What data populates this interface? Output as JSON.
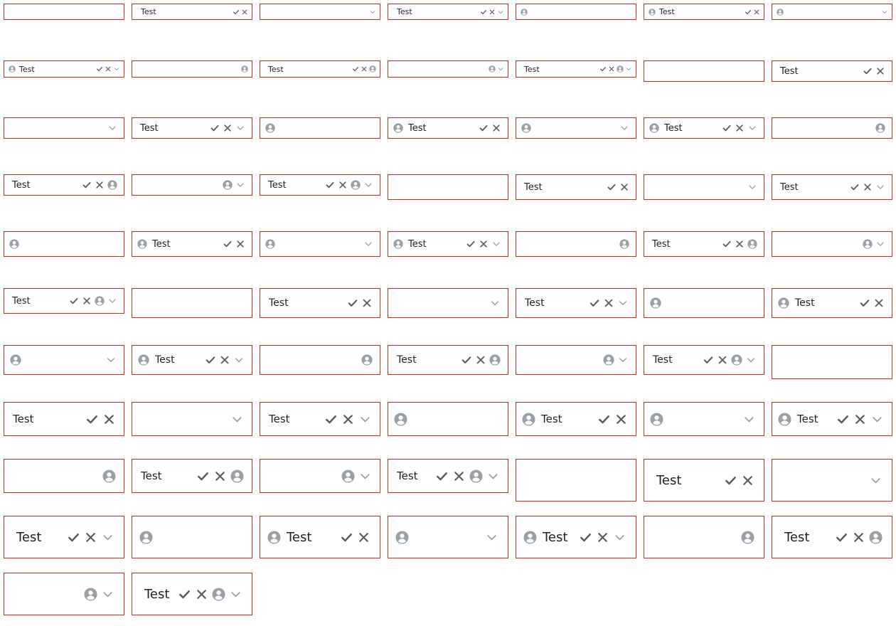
{
  "border_color": "#b7351c",
  "icon_names": {
    "leading": "avatar-icon",
    "confirm": "check-icon",
    "clear": "close-icon",
    "trailing": "avatar-icon",
    "dropdown": "chevron-down-icon"
  },
  "fields": [
    {
      "value": "",
      "lead": false,
      "check": false,
      "clear": false,
      "trail": false,
      "chev": false,
      "size": 1
    },
    {
      "value": "Test",
      "lead": false,
      "check": true,
      "clear": true,
      "trail": false,
      "chev": false,
      "size": 1
    },
    {
      "value": "",
      "lead": false,
      "check": false,
      "clear": false,
      "trail": false,
      "chev": true,
      "size": 1
    },
    {
      "value": "Test",
      "lead": false,
      "check": true,
      "clear": true,
      "trail": false,
      "chev": true,
      "size": 1
    },
    {
      "value": "",
      "lead": true,
      "check": false,
      "clear": false,
      "trail": false,
      "chev": false,
      "size": 1
    },
    {
      "value": "Test",
      "lead": true,
      "check": true,
      "clear": true,
      "trail": false,
      "chev": false,
      "size": 1
    },
    {
      "value": "",
      "lead": true,
      "check": false,
      "clear": false,
      "trail": false,
      "chev": true,
      "size": 1
    },
    {
      "value": "Test",
      "lead": true,
      "check": true,
      "clear": true,
      "trail": false,
      "chev": true,
      "size": 2
    },
    {
      "value": "",
      "lead": false,
      "check": false,
      "clear": false,
      "trail": true,
      "chev": false,
      "size": 2
    },
    {
      "value": "Test",
      "lead": false,
      "check": true,
      "clear": true,
      "trail": true,
      "chev": false,
      "size": 2
    },
    {
      "value": "",
      "lead": false,
      "check": false,
      "clear": false,
      "trail": true,
      "chev": true,
      "size": 2
    },
    {
      "value": "Test",
      "lead": false,
      "check": true,
      "clear": true,
      "trail": true,
      "chev": true,
      "size": 2
    },
    {
      "value": "",
      "lead": false,
      "check": false,
      "clear": false,
      "trail": false,
      "chev": false,
      "size": 3
    },
    {
      "value": "Test",
      "lead": false,
      "check": true,
      "clear": true,
      "trail": false,
      "chev": false,
      "size": 3
    },
    {
      "value": "",
      "lead": false,
      "check": false,
      "clear": false,
      "trail": false,
      "chev": true,
      "size": 3
    },
    {
      "value": "Test",
      "lead": false,
      "check": true,
      "clear": true,
      "trail": false,
      "chev": true,
      "size": 3
    },
    {
      "value": "",
      "lead": true,
      "check": false,
      "clear": false,
      "trail": false,
      "chev": false,
      "size": 3
    },
    {
      "value": "Test",
      "lead": true,
      "check": true,
      "clear": true,
      "trail": false,
      "chev": false,
      "size": 3
    },
    {
      "value": "",
      "lead": true,
      "check": false,
      "clear": false,
      "trail": false,
      "chev": true,
      "size": 3
    },
    {
      "value": "Test",
      "lead": true,
      "check": true,
      "clear": true,
      "trail": false,
      "chev": true,
      "size": 3
    },
    {
      "value": "",
      "lead": false,
      "check": false,
      "clear": false,
      "trail": true,
      "chev": false,
      "size": 3
    },
    {
      "value": "Test",
      "lead": false,
      "check": true,
      "clear": true,
      "trail": true,
      "chev": false,
      "size": 3
    },
    {
      "value": "",
      "lead": false,
      "check": false,
      "clear": false,
      "trail": true,
      "chev": true,
      "size": 3
    },
    {
      "value": "Test",
      "lead": false,
      "check": true,
      "clear": true,
      "trail": true,
      "chev": true,
      "size": 3
    },
    {
      "value": "",
      "lead": false,
      "check": false,
      "clear": false,
      "trail": false,
      "chev": false,
      "size": 4
    },
    {
      "value": "Test",
      "lead": false,
      "check": true,
      "clear": true,
      "trail": false,
      "chev": false,
      "size": 4
    },
    {
      "value": "",
      "lead": false,
      "check": false,
      "clear": false,
      "trail": false,
      "chev": true,
      "size": 4
    },
    {
      "value": "Test",
      "lead": false,
      "check": true,
      "clear": true,
      "trail": false,
      "chev": true,
      "size": 4
    },
    {
      "value": "",
      "lead": true,
      "check": false,
      "clear": false,
      "trail": false,
      "chev": false,
      "size": 4
    },
    {
      "value": "Test",
      "lead": true,
      "check": true,
      "clear": true,
      "trail": false,
      "chev": false,
      "size": 4
    },
    {
      "value": "",
      "lead": true,
      "check": false,
      "clear": false,
      "trail": false,
      "chev": true,
      "size": 4
    },
    {
      "value": "Test",
      "lead": true,
      "check": true,
      "clear": true,
      "trail": false,
      "chev": true,
      "size": 4
    },
    {
      "value": "",
      "lead": false,
      "check": false,
      "clear": false,
      "trail": true,
      "chev": false,
      "size": 4
    },
    {
      "value": "Test",
      "lead": false,
      "check": true,
      "clear": true,
      "trail": true,
      "chev": false,
      "size": 4
    },
    {
      "value": "",
      "lead": false,
      "check": false,
      "clear": false,
      "trail": true,
      "chev": true,
      "size": 4
    },
    {
      "value": "Test",
      "lead": false,
      "check": true,
      "clear": true,
      "trail": true,
      "chev": true,
      "size": 4
    },
    {
      "value": "",
      "lead": false,
      "check": false,
      "clear": false,
      "trail": false,
      "chev": false,
      "size": 5
    },
    {
      "value": "Test",
      "lead": false,
      "check": true,
      "clear": true,
      "trail": false,
      "chev": false,
      "size": 5
    },
    {
      "value": "",
      "lead": false,
      "check": false,
      "clear": false,
      "trail": false,
      "chev": true,
      "size": 5
    },
    {
      "value": "Test",
      "lead": false,
      "check": true,
      "clear": true,
      "trail": false,
      "chev": true,
      "size": 5
    },
    {
      "value": "",
      "lead": true,
      "check": false,
      "clear": false,
      "trail": false,
      "chev": false,
      "size": 5
    },
    {
      "value": "Test",
      "lead": true,
      "check": true,
      "clear": true,
      "trail": false,
      "chev": false,
      "size": 5
    },
    {
      "value": "",
      "lead": true,
      "check": false,
      "clear": false,
      "trail": false,
      "chev": true,
      "size": 5
    },
    {
      "value": "Test",
      "lead": true,
      "check": true,
      "clear": true,
      "trail": false,
      "chev": true,
      "size": 5
    },
    {
      "value": "",
      "lead": false,
      "check": false,
      "clear": false,
      "trail": true,
      "chev": false,
      "size": 5
    },
    {
      "value": "Test",
      "lead": false,
      "check": true,
      "clear": true,
      "trail": true,
      "chev": false,
      "size": 5
    },
    {
      "value": "",
      "lead": false,
      "check": false,
      "clear": false,
      "trail": true,
      "chev": true,
      "size": 5
    },
    {
      "value": "Test",
      "lead": false,
      "check": true,
      "clear": true,
      "trail": true,
      "chev": true,
      "size": 5
    },
    {
      "value": "",
      "lead": false,
      "check": false,
      "clear": false,
      "trail": false,
      "chev": false,
      "size": 6
    },
    {
      "value": "Test",
      "lead": false,
      "check": true,
      "clear": true,
      "trail": false,
      "chev": false,
      "size": 7
    },
    {
      "value": "",
      "lead": false,
      "check": false,
      "clear": false,
      "trail": false,
      "chev": true,
      "size": 7
    },
    {
      "value": "Test",
      "lead": false,
      "check": true,
      "clear": true,
      "trail": false,
      "chev": true,
      "size": 7
    },
    {
      "value": "",
      "lead": true,
      "check": false,
      "clear": false,
      "trail": false,
      "chev": false,
      "size": 7
    },
    {
      "value": "Test",
      "lead": true,
      "check": true,
      "clear": true,
      "trail": false,
      "chev": false,
      "size": 7
    },
    {
      "value": "",
      "lead": true,
      "check": false,
      "clear": false,
      "trail": false,
      "chev": true,
      "size": 7
    },
    {
      "value": "Test",
      "lead": true,
      "check": true,
      "clear": true,
      "trail": false,
      "chev": true,
      "size": 7
    },
    {
      "value": "",
      "lead": false,
      "check": false,
      "clear": false,
      "trail": true,
      "chev": false,
      "size": 7
    },
    {
      "value": "Test",
      "lead": false,
      "check": true,
      "clear": true,
      "trail": true,
      "chev": false,
      "size": 7
    },
    {
      "value": "",
      "lead": false,
      "check": false,
      "clear": false,
      "trail": true,
      "chev": true,
      "size": 7
    },
    {
      "value": "Test",
      "lead": false,
      "check": true,
      "clear": true,
      "trail": true,
      "chev": true,
      "size": 7
    },
    {
      "value": "",
      "lead": false,
      "check": false,
      "clear": false,
      "trail": false,
      "chev": false,
      "size": 8
    },
    {
      "value": "Test",
      "lead": false,
      "check": true,
      "clear": true,
      "trail": false,
      "chev": false,
      "size": 8
    },
    {
      "value": "",
      "lead": false,
      "check": false,
      "clear": false,
      "trail": false,
      "chev": true,
      "size": 8
    },
    {
      "value": "Test",
      "lead": false,
      "check": true,
      "clear": true,
      "trail": false,
      "chev": true,
      "size": 8
    },
    {
      "value": "",
      "lead": true,
      "check": false,
      "clear": false,
      "trail": false,
      "chev": false,
      "size": 8
    },
    {
      "value": "Test",
      "lead": true,
      "check": true,
      "clear": true,
      "trail": false,
      "chev": false,
      "size": 8
    },
    {
      "value": "",
      "lead": true,
      "check": false,
      "clear": false,
      "trail": false,
      "chev": true,
      "size": 8
    },
    {
      "value": "Test",
      "lead": true,
      "check": true,
      "clear": true,
      "trail": false,
      "chev": true,
      "size": 8
    },
    {
      "value": "",
      "lead": false,
      "check": false,
      "clear": false,
      "trail": true,
      "chev": false,
      "size": 8
    },
    {
      "value": "Test",
      "lead": false,
      "check": true,
      "clear": true,
      "trail": true,
      "chev": false,
      "size": 8
    },
    {
      "value": "",
      "lead": false,
      "check": false,
      "clear": false,
      "trail": true,
      "chev": true,
      "size": 8
    },
    {
      "value": "Test",
      "lead": false,
      "check": true,
      "clear": true,
      "trail": true,
      "chev": true,
      "size": 8
    }
  ]
}
